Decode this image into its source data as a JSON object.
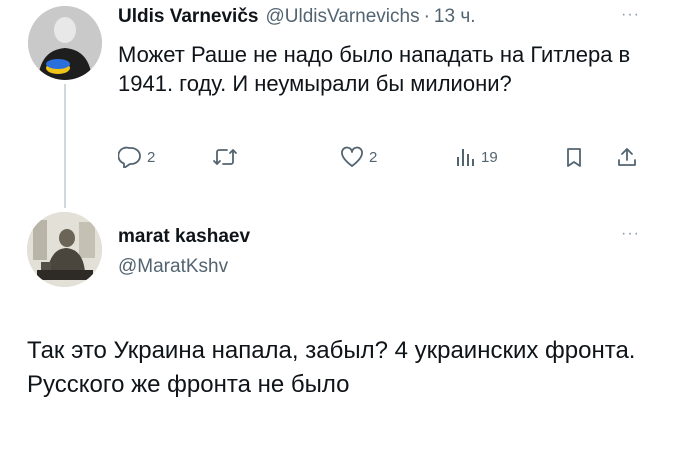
{
  "tweet1": {
    "author_name": "Uldis Varnevičs",
    "handle": "@UldisVarnevichs",
    "separator": "·",
    "time": "13 ч.",
    "more": "···",
    "text": "Может Раше не надо было нападать на Гитлера в 1941. году. И неумырали бы милиони?",
    "actions": {
      "reply_icon": "reply-icon",
      "reply_count": "2",
      "retweet_icon": "retweet-icon",
      "like_icon": "heart-icon",
      "like_count": "2",
      "views_icon": "views-icon",
      "views_count": "19",
      "bookmark_icon": "bookmark-icon",
      "share_icon": "share-icon"
    }
  },
  "tweet2": {
    "author_name": "marat kashaev",
    "handle": "@MaratKshv",
    "more": "···",
    "text": "Так это Украина напала, забыл? 4 украинских фронта. Русского же фронта не было"
  },
  "colors": {
    "text": "#0f1419",
    "secondary": "#536471",
    "thread_line": "#cfd9de"
  }
}
